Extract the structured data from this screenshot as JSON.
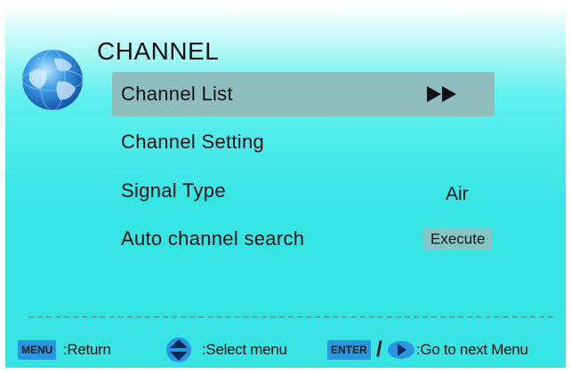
{
  "menu": {
    "title": "CHANNEL",
    "items": [
      {
        "label": "Channel List",
        "value_icon": "double-right-arrow-icon",
        "selected": true
      },
      {
        "label": "Channel Setting"
      },
      {
        "label": "Signal Type",
        "value": "Air"
      },
      {
        "label": "Auto channel search",
        "action": "Execute"
      }
    ]
  },
  "footer": {
    "menu_key": "MENU",
    "menu_text": ":Return",
    "select_icon": "up-down-arrows-icon",
    "select_text": ":Select menu",
    "enter_key": "ENTER",
    "separator": "/",
    "next_icon": "right-arrow-button-icon",
    "next_text": ":Go to next Menu"
  },
  "colors": {
    "background": "#36e4e4",
    "selected_row": "#8fbcbc",
    "execute_box": "#84c6c6",
    "key_button": "#2a96e0"
  }
}
